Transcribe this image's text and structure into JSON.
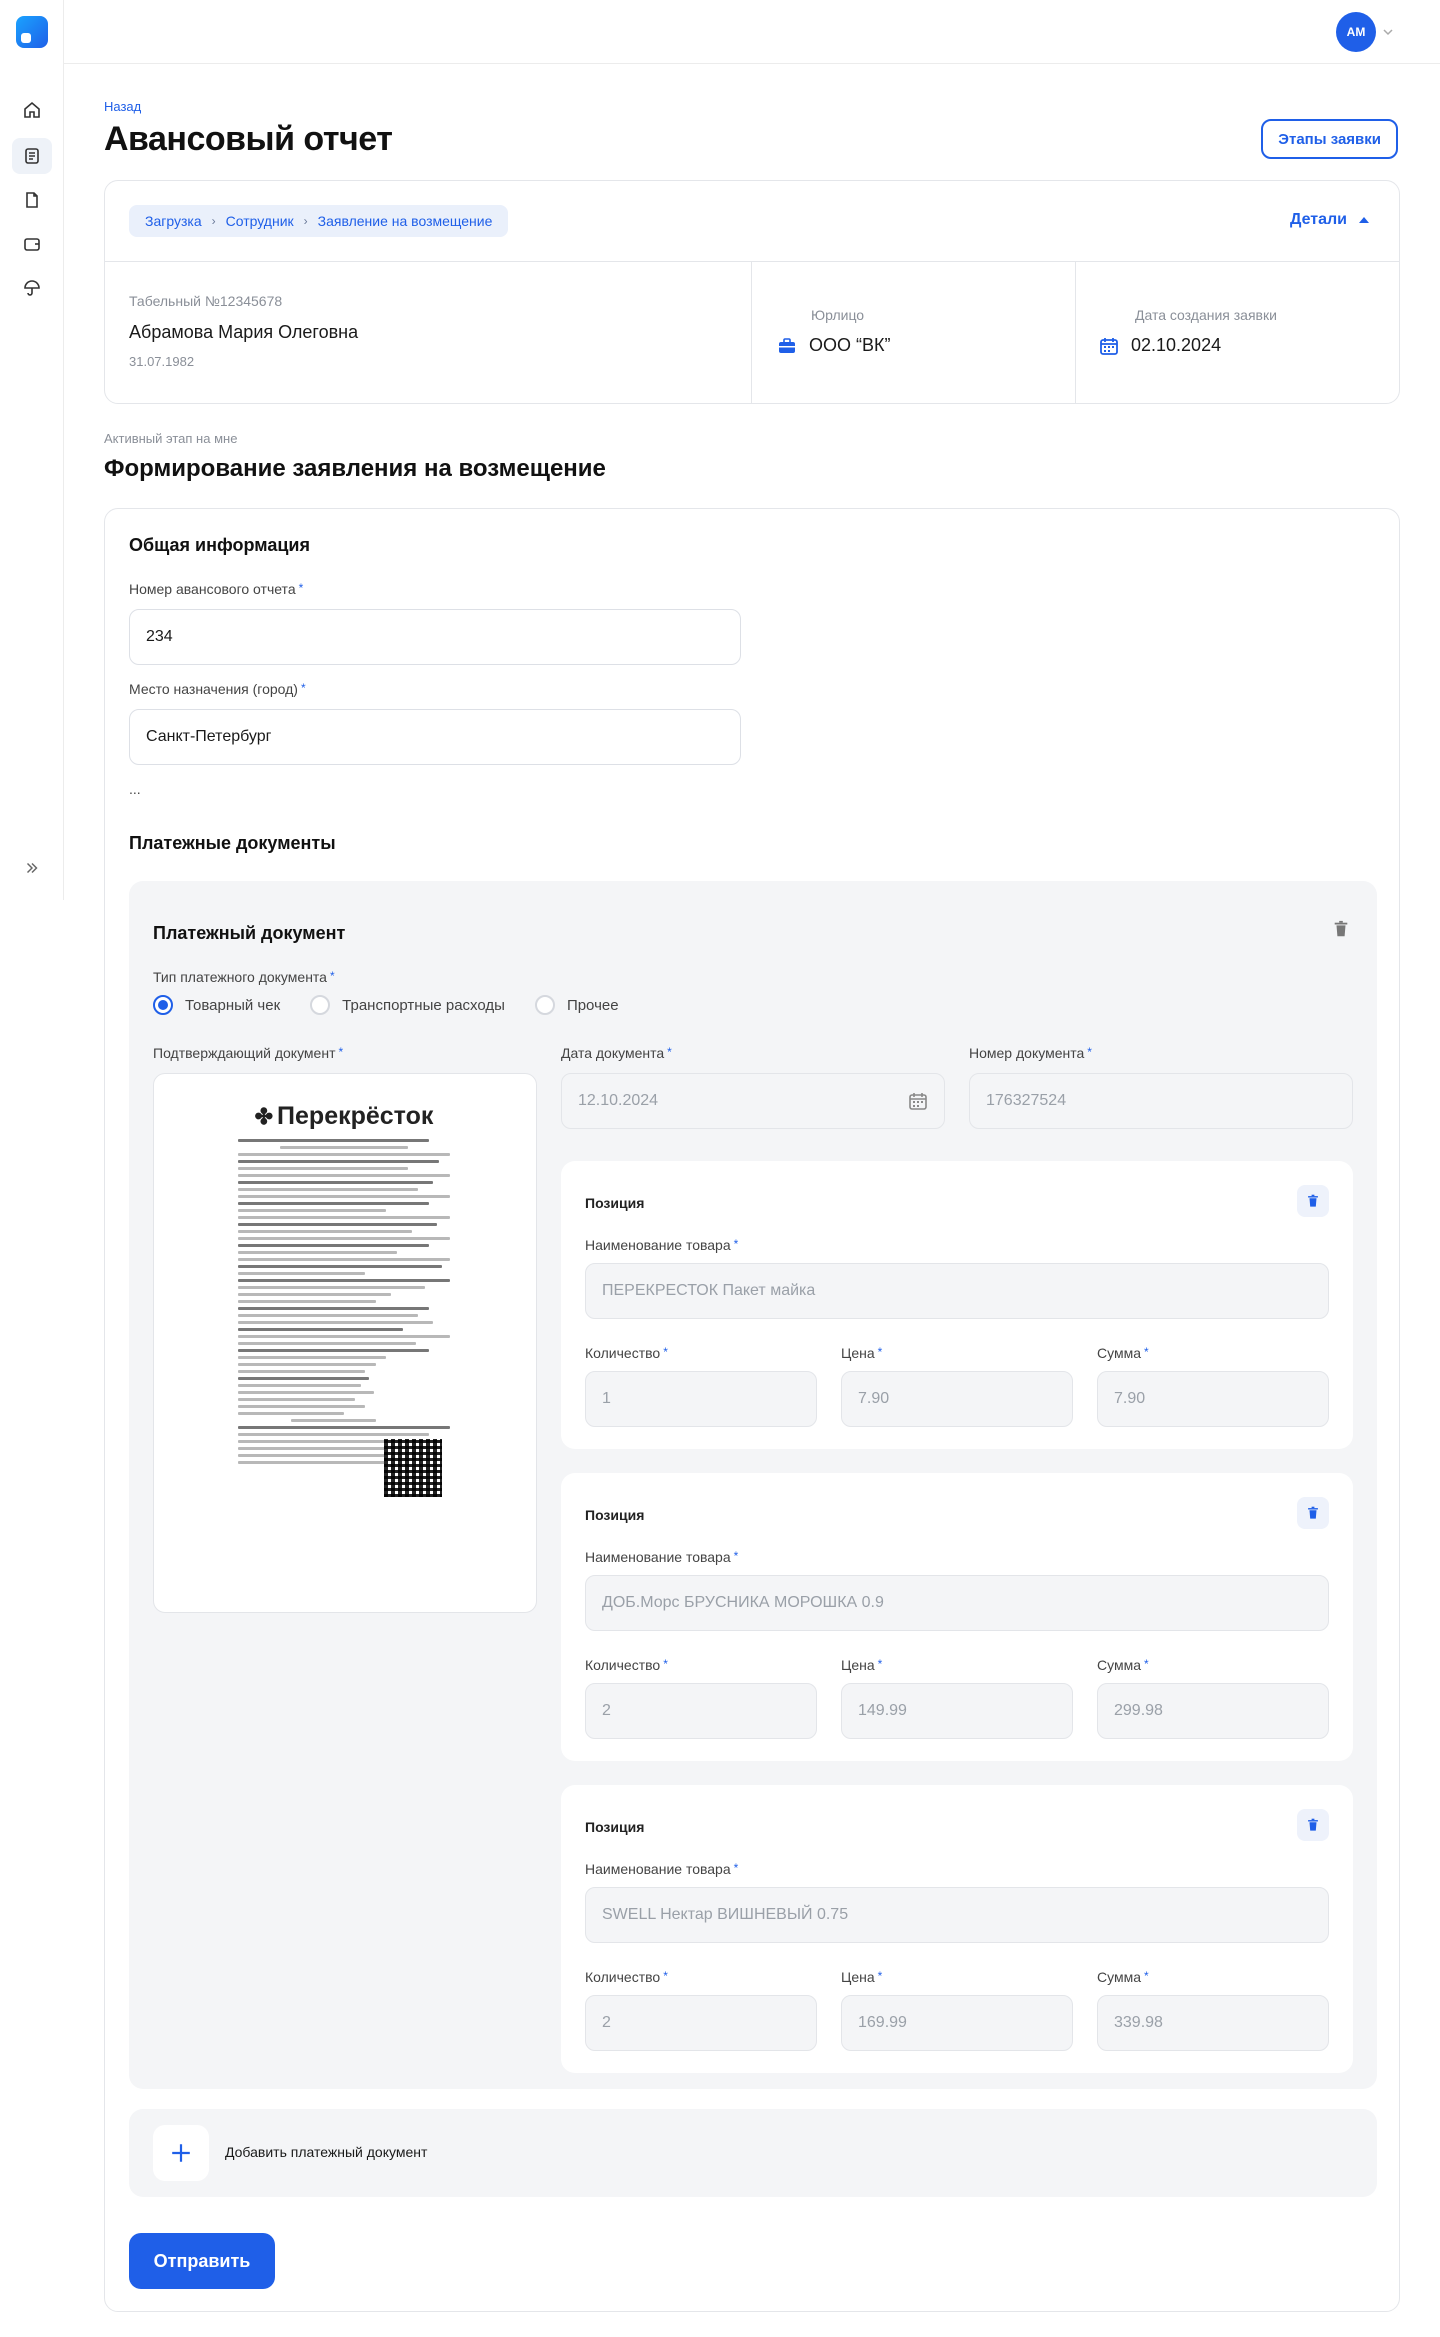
{
  "header": {
    "back_label": "Назад",
    "title": "Авансовый отчет",
    "stages_button": "Этапы заявки",
    "avatar_initials": "АМ"
  },
  "breadcrumb": [
    "Загрузка",
    "Сотрудник",
    "Заявление на возмещение"
  ],
  "details_toggle": "Детали",
  "employee": {
    "tab_number": "Табельный №12345678",
    "name": "Абрамова Мария Олеговна",
    "dob": "31.07.1982"
  },
  "legal_entity": {
    "label": "Юрлицо",
    "value": "ООО “ВК”"
  },
  "created": {
    "label": "Дата создания заявки",
    "value": "02.10.2024"
  },
  "stage": {
    "label": "Активный этап на мне",
    "title": "Формирование заявления на возмещение"
  },
  "general": {
    "title": "Общая информация",
    "report_number_label": "Номер авансового отчета",
    "report_number_value": "234",
    "destination_label": "Место назначения (город)",
    "destination_value": "Санкт-Петербург",
    "ellipsis": "..."
  },
  "payment_docs": {
    "title": "Платежные документы",
    "doc": {
      "title": "Платежный документ",
      "type_label": "Тип платежного документа",
      "types": [
        "Товарный чек",
        "Транспортные расходы",
        "Прочее"
      ],
      "selected_type": "Товарный чек",
      "proof_label": "Подтверждающий документ",
      "receipt_logo": "Перекрёсток",
      "date_label": "Дата документа",
      "date_value": "12.10.2024",
      "number_label": "Номер документа",
      "number_value": "176327524",
      "positions": [
        {
          "title": "Позиция",
          "name_label": "Наименование товара",
          "name": "ПЕРЕКРЕСТОК Пакет майка",
          "qty_label": "Количество",
          "qty": "1",
          "price_label": "Цена",
          "price": "7.90",
          "sum_label": "Сумма",
          "sum": "7.90"
        },
        {
          "title": "Позиция",
          "name_label": "Наименование товара",
          "name": "ДОБ.Морс БРУСНИКА МОРОШКА 0.9",
          "qty_label": "Количество",
          "qty": "2",
          "price_label": "Цена",
          "price": "149.99",
          "sum_label": "Сумма",
          "sum": "299.98"
        },
        {
          "title": "Позиция",
          "name_label": "Наименование товара",
          "name": "SWELL Нектар ВИШНЕВЫЙ 0.75",
          "qty_label": "Количество",
          "qty": "2",
          "price_label": "Цена",
          "price": "169.99",
          "sum_label": "Сумма",
          "sum": "339.98"
        }
      ]
    },
    "add_label": "Добавить платежный документ"
  },
  "submit_label": "Отправить",
  "colors": {
    "accent": "#1f5fe8",
    "muted": "#8a8f98",
    "panel": "#f4f5f7"
  }
}
